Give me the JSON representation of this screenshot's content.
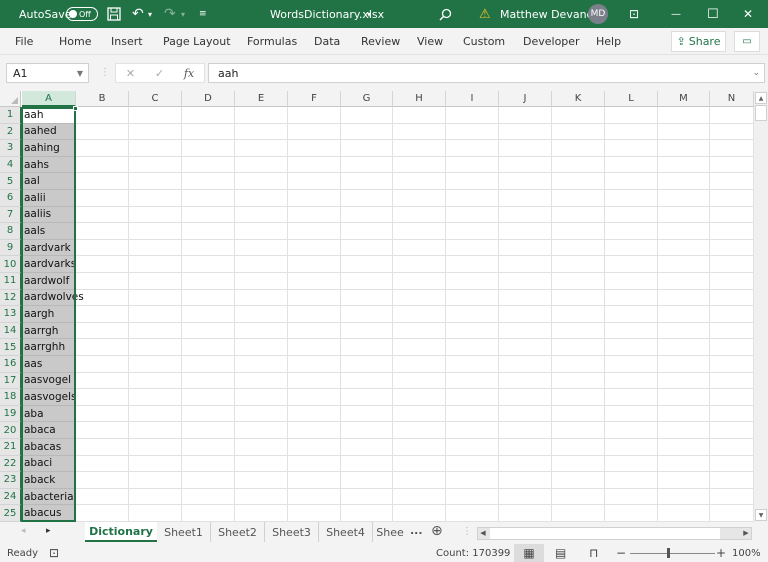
{
  "titlebar": {
    "autosave_label": "AutoSave",
    "autosave_state": "Off",
    "filename": "WordsDictionary.xlsx",
    "filename_dropdown": "▾",
    "user_name": "Matthew Devaney",
    "user_initials": "MD",
    "icons": {
      "save": "💾",
      "undo": "↶",
      "redo": "↷",
      "dropdown": "▾",
      "customize": "≡",
      "search": "⚲",
      "warning": "⚠",
      "ribbon_display": "⊡",
      "minimize": "—",
      "maximize": "☐",
      "close": "✕"
    }
  },
  "ribbon": {
    "tabs": [
      "File",
      "Home",
      "Insert",
      "Page Layout",
      "Formulas",
      "Data",
      "Review",
      "View",
      "Custom",
      "Developer",
      "Help"
    ],
    "share_label": "Share",
    "share_icon": "⇪",
    "comment_icon": "▭"
  },
  "formula_bar": {
    "name_box": "A1",
    "cancel_icon": "✕",
    "enter_icon": "✓",
    "fx_label": "fx",
    "value": "aah",
    "expand_icon": "⌄"
  },
  "grid": {
    "columns": [
      "A",
      "B",
      "C",
      "D",
      "E",
      "F",
      "G",
      "H",
      "I",
      "J",
      "K",
      "L",
      "M",
      "N"
    ],
    "selected_column": "A",
    "active_cell": "A1",
    "rows": [
      {
        "n": "1",
        "a": "aah"
      },
      {
        "n": "2",
        "a": "aahed"
      },
      {
        "n": "3",
        "a": "aahing"
      },
      {
        "n": "4",
        "a": "aahs"
      },
      {
        "n": "5",
        "a": "aal"
      },
      {
        "n": "6",
        "a": "aalii"
      },
      {
        "n": "7",
        "a": "aaliis"
      },
      {
        "n": "8",
        "a": "aals"
      },
      {
        "n": "9",
        "a": "aardvark"
      },
      {
        "n": "10",
        "a": "aardvarks"
      },
      {
        "n": "11",
        "a": "aardwolf"
      },
      {
        "n": "12",
        "a": "aardwolves"
      },
      {
        "n": "13",
        "a": "aargh"
      },
      {
        "n": "14",
        "a": "aarrgh"
      },
      {
        "n": "15",
        "a": "aarrghh"
      },
      {
        "n": "16",
        "a": "aas"
      },
      {
        "n": "17",
        "a": "aasvogel"
      },
      {
        "n": "18",
        "a": "aasvogels"
      },
      {
        "n": "19",
        "a": "aba"
      },
      {
        "n": "20",
        "a": "abaca"
      },
      {
        "n": "21",
        "a": "abacas"
      },
      {
        "n": "22",
        "a": "abaci"
      },
      {
        "n": "23",
        "a": "aback"
      },
      {
        "n": "24",
        "a": "abacterial"
      },
      {
        "n": "25",
        "a": "abacus"
      }
    ]
  },
  "sheet_tabs": {
    "prev_icon": "◂",
    "next_icon": "▸",
    "tabs": [
      "Dictionary",
      "Sheet1",
      "Sheet2",
      "Sheet3",
      "Sheet4",
      "Shee"
    ],
    "active": "Dictionary",
    "more_label": "...",
    "add_icon": "⊕"
  },
  "status_bar": {
    "ready": "Ready",
    "macro_icon": "⊡",
    "count": "Count: 170399",
    "view_normal_icon": "▦",
    "view_page_layout_icon": "▤",
    "view_page_break_icon": "⊓",
    "zoom_out": "−",
    "zoom_in": "+",
    "zoom_level": "100%"
  }
}
